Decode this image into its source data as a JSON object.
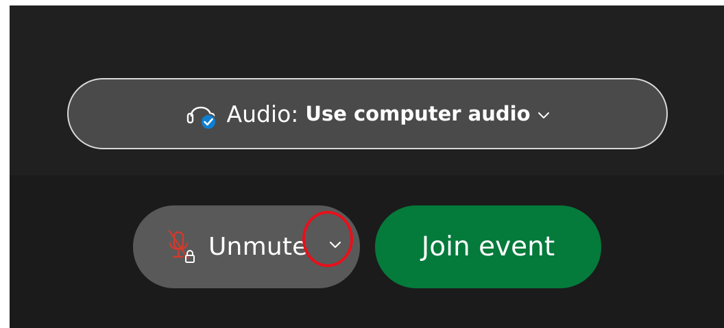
{
  "audio": {
    "label": "Audio:",
    "value": "Use computer audio",
    "icon": "headset-check-icon",
    "chevron_icon": "chevron-down-icon",
    "check_color": "#0f7fd3"
  },
  "mic": {
    "label": "Unmute",
    "icon": "muted-microphone-locked-icon",
    "icon_color": "#d23a2c",
    "caret_icon": "chevron-down-icon"
  },
  "join": {
    "label": "Join event",
    "color": "#047a3b"
  },
  "annotation": {
    "ring_color": "#e8101a"
  }
}
